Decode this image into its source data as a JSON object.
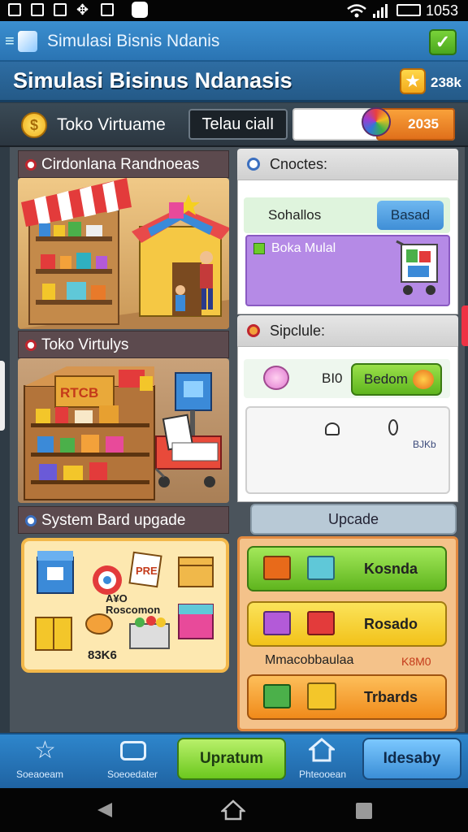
{
  "status_bar": {
    "time": "1053"
  },
  "title_bar": {
    "app_name": "Simulasi Bisnis Ndanis"
  },
  "header": {
    "game_title": "Simulasi Bisinus Ndanasis",
    "star_count": "238k"
  },
  "shop_bar": {
    "shop_name": "Toko Virtuame",
    "shop_field": "Telau cialI",
    "coin_value": "2035"
  },
  "left_sections": [
    {
      "title": "Cirdonlana Randnoeas"
    },
    {
      "title": "Toko Virtulys"
    },
    {
      "title": "System Bard upgade",
      "upgrade_label": "A¥O\nRoscomon",
      "upgrade_value": "83K6",
      "sign_text": "PRE"
    }
  ],
  "right_panel_1": {
    "header": "Cnoctes:",
    "row_label": "Sohallos",
    "row_button": "Basad",
    "purple_label": "Boka Mulal"
  },
  "right_panel_2": {
    "header": "Sipclule:",
    "value_label": "BI0",
    "green_button": "Bedom",
    "box_value": "BJKb"
  },
  "upgrade_panel": {
    "tab_label": "Upcade",
    "buttons": [
      {
        "label": "Kosnda",
        "color": "green"
      },
      {
        "label": "Rosado",
        "color": "yellow"
      },
      {
        "label": "Trbards",
        "color": "orange"
      }
    ],
    "info_label": "Mmacobbaulaa",
    "info_value": "K8M0"
  },
  "bottom_nav": {
    "items": [
      {
        "label": "Soeaoeam",
        "icon": "star-icon"
      },
      {
        "label": "Soeoedater",
        "icon": "chat-icon"
      },
      {
        "label": "Upratum",
        "icon": ""
      },
      {
        "label": "Phteooean",
        "icon": "home-icon"
      },
      {
        "label": "Idesaby",
        "icon": ""
      }
    ]
  },
  "colors": {
    "accent_blue": "#2a74b3",
    "green": "#6ccb2a",
    "orange": "#f3a13a",
    "purple": "#b58ae6"
  }
}
